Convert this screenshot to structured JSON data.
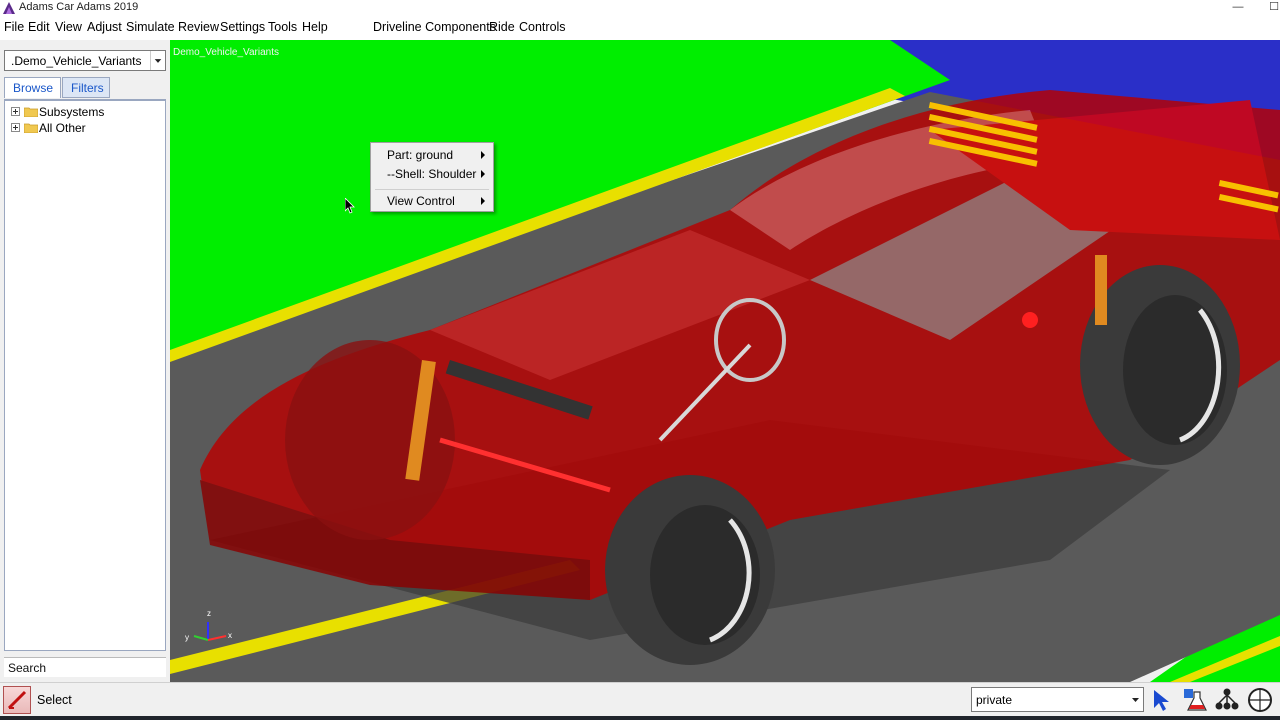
{
  "window": {
    "title": "Adams Car Adams 2019",
    "minimize_glyph": "—",
    "maximize_glyph": "☐"
  },
  "menus": {
    "main": [
      "File",
      "Edit",
      "View",
      "Adjust",
      "Simulate",
      "Review",
      "Settings",
      "Tools",
      "Help"
    ],
    "plugin": [
      "Driveline Components",
      "Ride",
      "Controls"
    ]
  },
  "left_panel": {
    "model_select": ".Demo_Vehicle_Variants",
    "tabs": [
      "Browse",
      "Filters"
    ],
    "active_tab": "Browse",
    "tree": [
      {
        "label": "Subsystems",
        "expandable": true
      },
      {
        "label": "All Other",
        "expandable": true
      }
    ],
    "search_label": "Search"
  },
  "viewport": {
    "model_label": "Demo_Vehicle_Variants",
    "triad_labels": {
      "z": "z",
      "y": "y",
      "x": "x"
    },
    "colors": {
      "ground_green": "#00f000",
      "sky_blue": "#2a2fc8",
      "road_gray": "#5a5a5a",
      "lane_yellow": "#e8e000",
      "body_red": "#d40000",
      "tire": "#3a3a3a"
    }
  },
  "context_menu": {
    "items": [
      {
        "label": "Part: ground",
        "has_submenu": true
      },
      {
        "label": "--Shell: Shoulder",
        "has_submenu": true
      },
      {
        "label": "View Control",
        "has_submenu": true
      }
    ]
  },
  "status_bar": {
    "tool_label": "Select",
    "project_select": "private",
    "icons": [
      "select-arrow-icon",
      "flask-icon",
      "network-icon",
      "view-orientation-icon"
    ]
  }
}
